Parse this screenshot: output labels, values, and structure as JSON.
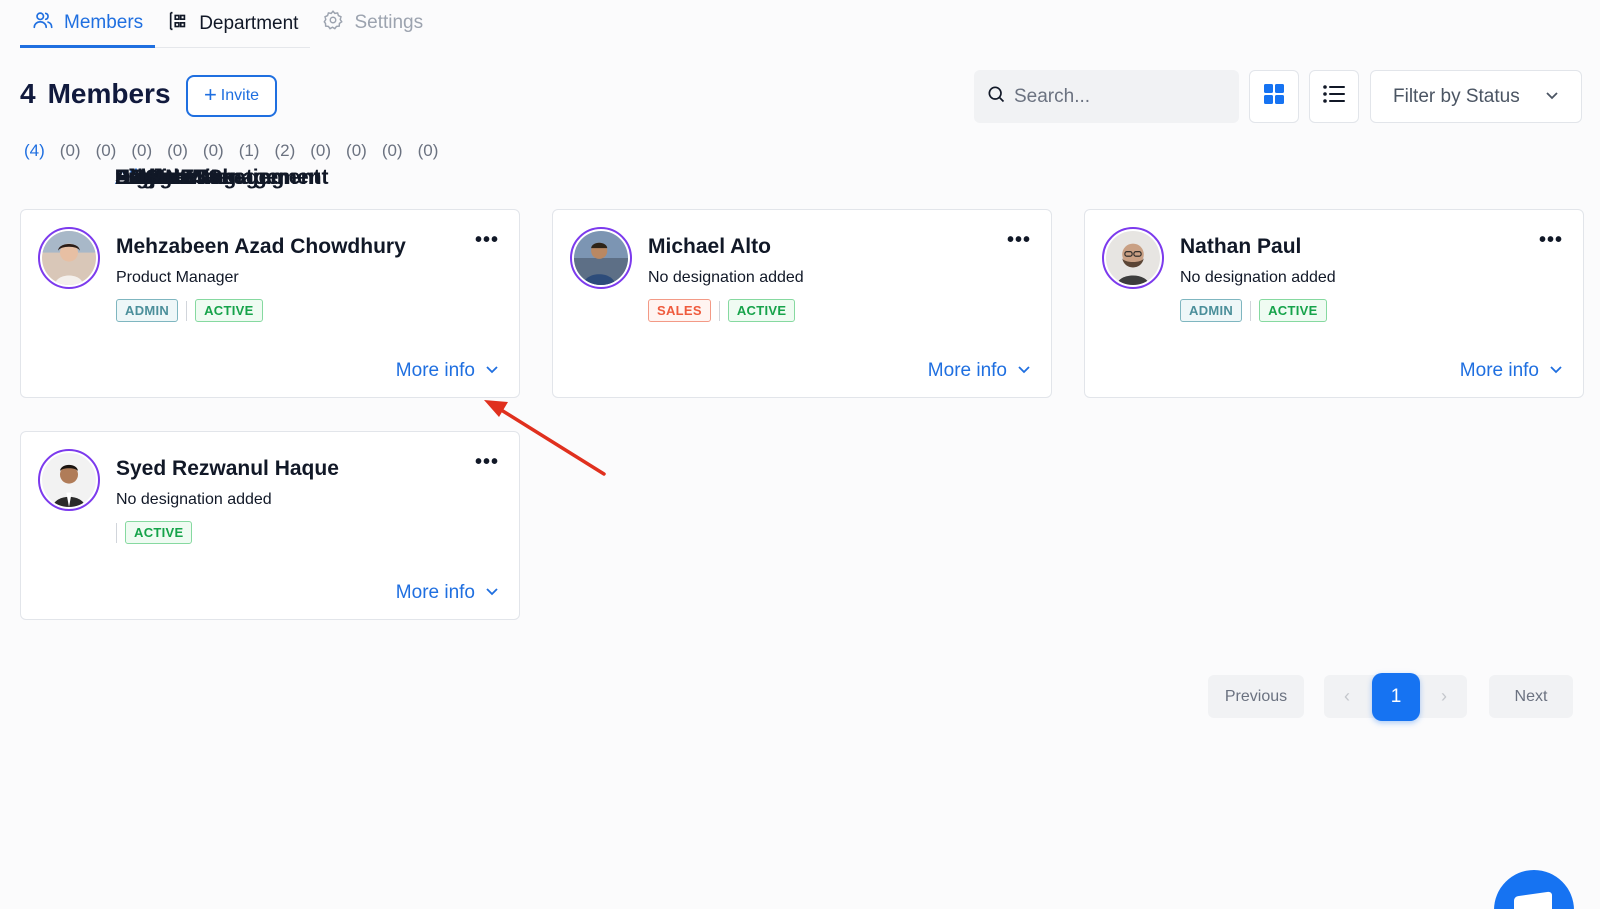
{
  "tabs": [
    {
      "label": "Members",
      "icon": "users-icon",
      "state": "active"
    },
    {
      "label": "Department",
      "icon": "department-icon",
      "state": "normal"
    },
    {
      "label": "Settings",
      "icon": "gear-icon",
      "state": "disabled"
    }
  ],
  "header": {
    "count": "4",
    "title": "Members",
    "invite_label": "Invite",
    "search_placeholder": "Search...",
    "filter_label": "Filter by Status"
  },
  "departments": [
    {
      "name": "All",
      "count": "(4)"
    },
    {
      "name": "Engineering",
      "count": "(0)"
    },
    {
      "name": "Design",
      "count": "(0)"
    },
    {
      "name": "Digital Marketing",
      "count": "(0)"
    },
    {
      "name": "HR",
      "count": "(0)"
    },
    {
      "name": "Finance",
      "count": "(0)"
    },
    {
      "name": "Sales",
      "count": "(1)"
    },
    {
      "name": "Admin",
      "count": "(2)"
    },
    {
      "name": "Product Management",
      "count": "(0)"
    },
    {
      "name": "Project Management",
      "count": "(0)"
    },
    {
      "name": "LAW",
      "count": "(0)"
    },
    {
      "name": "BUSINESS",
      "count": "(0)"
    }
  ],
  "members": [
    {
      "name": "Mehzabeen Azad Chowdhury",
      "designation": "Product Manager",
      "role": "ADMIN",
      "status": "ACTIVE",
      "more_info": "More info"
    },
    {
      "name": "Michael Alto",
      "designation": "No designation added",
      "role": "SALES",
      "status": "ACTIVE",
      "more_info": "More info"
    },
    {
      "name": "Nathan Paul",
      "designation": "No designation added",
      "role": "ADMIN",
      "status": "ACTIVE",
      "more_info": "More info"
    },
    {
      "name": "Syed Rezwanul Haque",
      "designation": "No designation added",
      "role": "",
      "status": "ACTIVE",
      "more_info": "More info"
    }
  ],
  "pagination": {
    "previous": "Previous",
    "next": "Next",
    "current": "1"
  },
  "colors": {
    "accent": "#1f6fe0",
    "avatar_ring": "#7c3aed",
    "annotation_arrow": "#e0301e"
  }
}
